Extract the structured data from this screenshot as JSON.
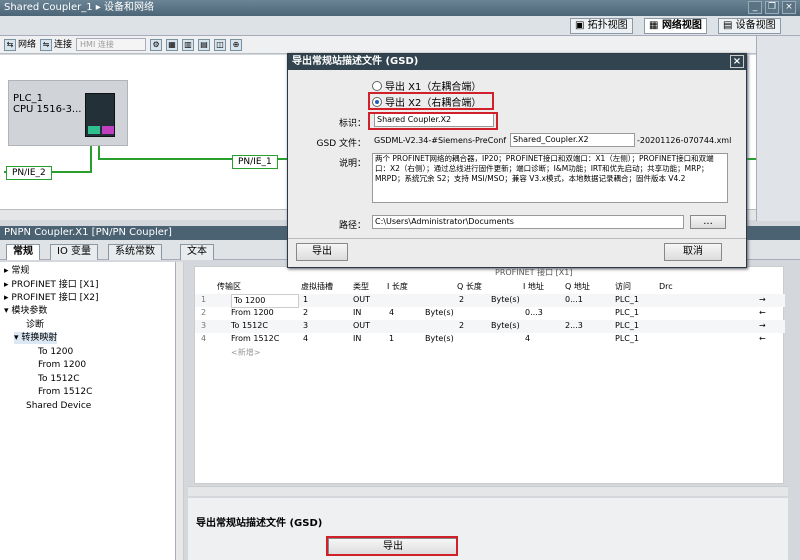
{
  "window": {
    "title": "Shared Coupler_1 ▸ 设备和网络"
  },
  "view_tabs": [
    "拓扑视图",
    "网络视图",
    "设备视图"
  ],
  "toolbar": {
    "network": "网络",
    "connection": "连接",
    "hmi": "HMI 连接"
  },
  "canvas": {
    "plc_name": "PLC_1",
    "plc_cpu": "CPU 1516-3...",
    "net1": "PN/IE_1",
    "net2": "PN/IE_2"
  },
  "dialog": {
    "title": "导出常规站描述文件 (GSD)",
    "radio_x1": "导出 X1（左耦合端）",
    "radio_x2": "导出 X2（右耦合端）",
    "id_label": "标识：",
    "id_value": "Shared Coupler.X2",
    "gsd_label": "GSD 文件：",
    "gsd_prefix": "GSDML-V2.34-#Siemens-PreConf",
    "gsd_mid": "Shared_Coupler.X2",
    "gsd_suffix": "-20201126-070744.xml",
    "desc_label": "说明：",
    "desc_value": "两个 PROFINET网络的耦合器，IP20；PROFINET接口和双端口：X1（左侧）；PROFINET接口和双端口：X2（右侧）；通过总线进行固件更新；端口诊断；I&M功能；IRT和优先启动；共享功能；MRP；MRPD；系统冗余 S2；支持 MSI/MSO；兼容 V3.x模式，本地数据记录耦合；固件版本 V4.2",
    "path_label": "路径：",
    "path_value": "C:\\Users\\Administrator\\Documents",
    "browse": "...",
    "export_btn": "导出",
    "cancel_btn": "取消"
  },
  "panel": {
    "title": "PNPN Coupler.X1 [PN/PN Coupler]",
    "tabs": [
      "常规",
      "IO 变量",
      "系统常数",
      "文本"
    ]
  },
  "tree": [
    "常规",
    "PROFINET 接口 [X1]",
    "PROFINET 接口 [X2]",
    "模块参数",
    "诊断",
    "转换映射",
    "To 1200",
    "From 1200",
    "To 1512C",
    "From 1512C",
    "Shared Device"
  ],
  "table": {
    "group_header": "PROFINET 接口 [X1]",
    "headers": [
      "传输区",
      "虚拟插槽",
      "类型",
      "I 长度",
      "Q 长度",
      "I 地址",
      "Q 地址",
      "访问",
      "Drc"
    ],
    "rows": [
      {
        "n": "1",
        "name": "To 1200",
        "slot": "1",
        "type": "OUT",
        "ilen": "",
        "iunit": "",
        "qlen": "2",
        "qunit": "Byte(s)",
        "iaddr": "",
        "qaddr": "0...1",
        "access": "PLC_1",
        "dir": "→"
      },
      {
        "n": "2",
        "name": "From 1200",
        "slot": "2",
        "type": "IN",
        "ilen": "4",
        "iunit": "Byte(s)",
        "qlen": "",
        "qunit": "",
        "iaddr": "0...3",
        "qaddr": "",
        "access": "PLC_1",
        "dir": "←"
      },
      {
        "n": "3",
        "name": "To 1512C",
        "slot": "3",
        "type": "OUT",
        "ilen": "",
        "iunit": "",
        "qlen": "2",
        "qunit": "Byte(s)",
        "iaddr": "",
        "qaddr": "2...3",
        "access": "PLC_1",
        "dir": "→"
      },
      {
        "n": "4",
        "name": "From 1512C",
        "slot": "4",
        "type": "IN",
        "ilen": "1",
        "iunit": "Byte(s)",
        "qlen": "",
        "qunit": "",
        "iaddr": "4",
        "qaddr": "",
        "access": "PLC_1",
        "dir": "←"
      }
    ],
    "add_new": "<新增>"
  },
  "bottom": {
    "title": "导出常规站描述文件 (GSD)",
    "export_btn": "导出"
  },
  "colors": {
    "highlight": "#d0202a",
    "network": "#29a02e",
    "title_bar": "#4c6576"
  }
}
